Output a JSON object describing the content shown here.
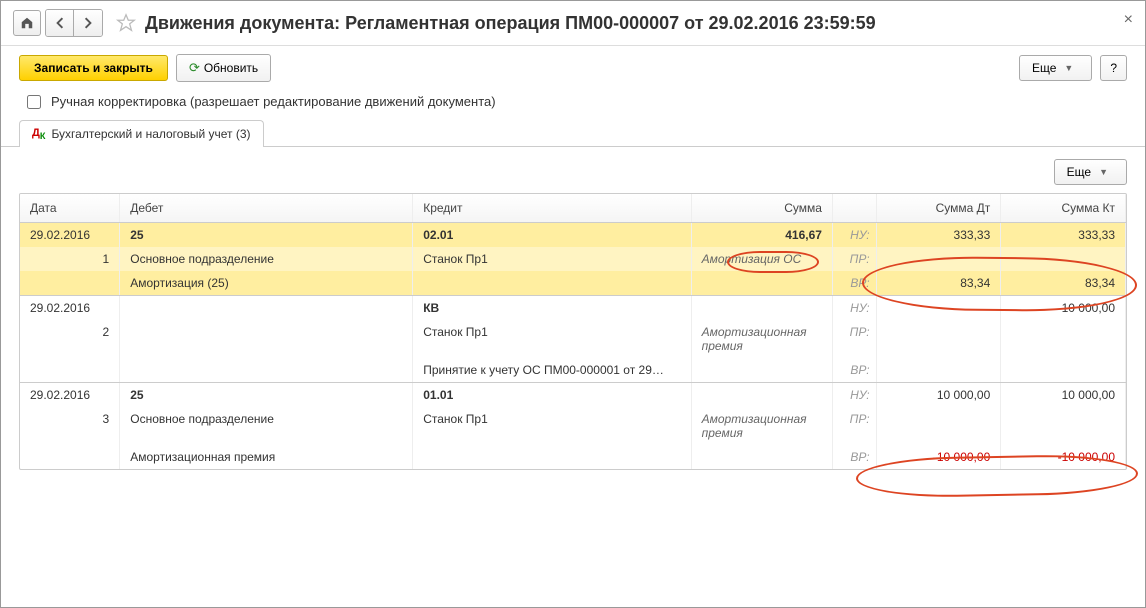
{
  "title": "Движения документа: Регламентная операция ПМ00-000007 от 29.02.2016 23:59:59",
  "toolbar": {
    "save_close": "Записать и закрыть",
    "refresh": "Обновить",
    "more": "Еще",
    "help": "?"
  },
  "manual_edit_label": "Ручная корректировка (разрешает редактирование движений документа)",
  "tab_label": "Бухгалтерский и налоговый учет (3)",
  "headers": {
    "date": "Дата",
    "debit": "Дебет",
    "credit": "Кредит",
    "sum": "Сумма",
    "sum_dt": "Сумма Дт",
    "sum_kt": "Сумма Кт"
  },
  "inner_more": "Еще",
  "labels": {
    "nu": "НУ:",
    "pr": "ПР:",
    "vr": "ВР:"
  },
  "entries": [
    {
      "date": "29.02.2016",
      "n": "1",
      "debit_acc": "25",
      "debit_sub1": "Основное подразделение",
      "debit_sub2": "Амортизация (25)",
      "credit_acc": "02.01",
      "credit_sub1": "Станок Пр1",
      "credit_sub2": "",
      "sum": "416,67",
      "desc": "Амортизация ОС",
      "nu_dt": "333,33",
      "nu_kt": "333,33",
      "pr_dt": "",
      "pr_kt": "",
      "vr_dt": "83,34",
      "vr_kt": "83,34",
      "hl": true
    },
    {
      "date": "29.02.2016",
      "n": "2",
      "debit_acc": "",
      "debit_sub1": "",
      "debit_sub2": "",
      "credit_acc": "КВ",
      "credit_sub1": "Станок Пр1",
      "credit_sub2": "Принятие к учету ОС ПМ00-000001 от 29…",
      "sum": "",
      "desc": "Амортизационная премия",
      "nu_dt": "",
      "nu_kt": "10 000,00",
      "pr_dt": "",
      "pr_kt": "",
      "vr_dt": "",
      "vr_kt": "",
      "hl": false
    },
    {
      "date": "29.02.2016",
      "n": "3",
      "debit_acc": "25",
      "debit_sub1": "Основное подразделение",
      "debit_sub2": "Амортизационная премия",
      "credit_acc": "01.01",
      "credit_sub1": "Станок Пр1",
      "credit_sub2": "",
      "sum": "",
      "desc": "Амортизационная премия",
      "nu_dt": "10 000,00",
      "nu_kt": "10 000,00",
      "pr_dt": "",
      "pr_kt": "",
      "vr_dt": "-10 000,00",
      "vr_kt": "-10 000,00",
      "hl": false,
      "neg": true
    }
  ]
}
